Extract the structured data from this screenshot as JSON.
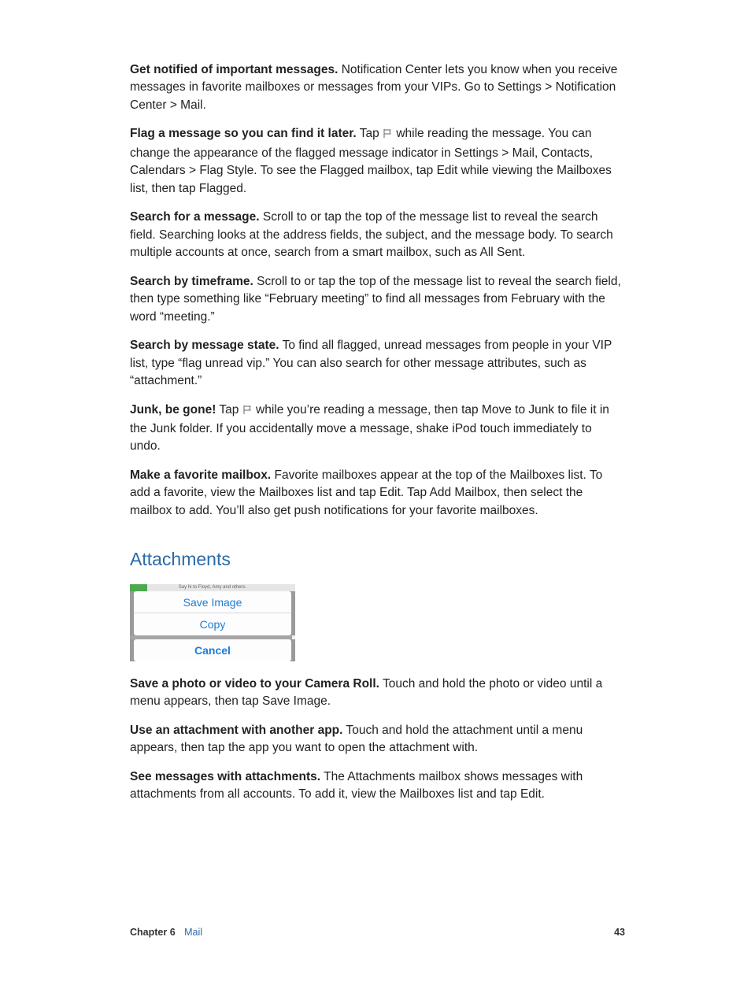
{
  "p1": {
    "lead": "Get notified of important messages.",
    "body": " Notification Center lets you know when you receive messages in favorite mailboxes or messages from your VIPs. Go to Settings > Notification Center > Mail."
  },
  "p2": {
    "lead": "Flag a message so you can find it later.",
    "body1": " Tap ",
    "body2": " while reading the message. You can change the appearance of the flagged message indicator in Settings > Mail, Contacts, Calendars > Flag Style. To see the Flagged mailbox, tap Edit while viewing the Mailboxes list, then tap Flagged."
  },
  "p3": {
    "lead": "Search for a message.",
    "body": " Scroll to or tap the top of the message list to reveal the search field. Searching looks at the address fields, the subject, and the message body. To search multiple accounts at once, search from a smart mailbox, such as All Sent."
  },
  "p4": {
    "lead": "Search by timeframe.",
    "body": " Scroll to or tap the top of the message list to reveal the search field, then type something like “February meeting” to find all messages from February with the word “meeting.”"
  },
  "p5": {
    "lead": "Search by message state.",
    "body": " To find all flagged, unread messages from people in your VIP list, type “flag unread vip.” You can also search for other message attributes, such as “attachment.”"
  },
  "p6": {
    "lead": "Junk, be gone!",
    "body1": " Tap ",
    "body2": " while you’re reading a message, then tap Move to Junk to file it in the Junk folder. If you accidentally move a message, shake iPod touch immediately to undo."
  },
  "p7": {
    "lead": "Make a favorite mailbox.",
    "body": " Favorite mailboxes appear at the top of the Mailboxes list. To add a favorite, view the Mailboxes list and tap Edit. Tap Add Mailbox, then select the mailbox to add. You’ll also get push notifications for your favorite mailboxes."
  },
  "heading": "Attachments",
  "actionsheet": {
    "hint": "Say hi to Floyd, Amy and others.",
    "save": "Save Image",
    "copy": "Copy",
    "cancel": "Cancel"
  },
  "p8": {
    "lead": "Save a photo or video to your Camera Roll.",
    "body": " Touch and hold the photo or video until a menu appears, then tap Save Image."
  },
  "p9": {
    "lead": "Use an attachment with another app.",
    "body": " Touch and hold the attachment until a menu appears, then tap the app you want to open the attachment with."
  },
  "p10": {
    "lead": "See messages with attachments.",
    "body": " The Attachments mailbox shows messages with attachments from all accounts. To add it, view the Mailboxes list and tap Edit."
  },
  "footer": {
    "chapter": "Chapter  6",
    "name": "Mail",
    "page": "43"
  }
}
